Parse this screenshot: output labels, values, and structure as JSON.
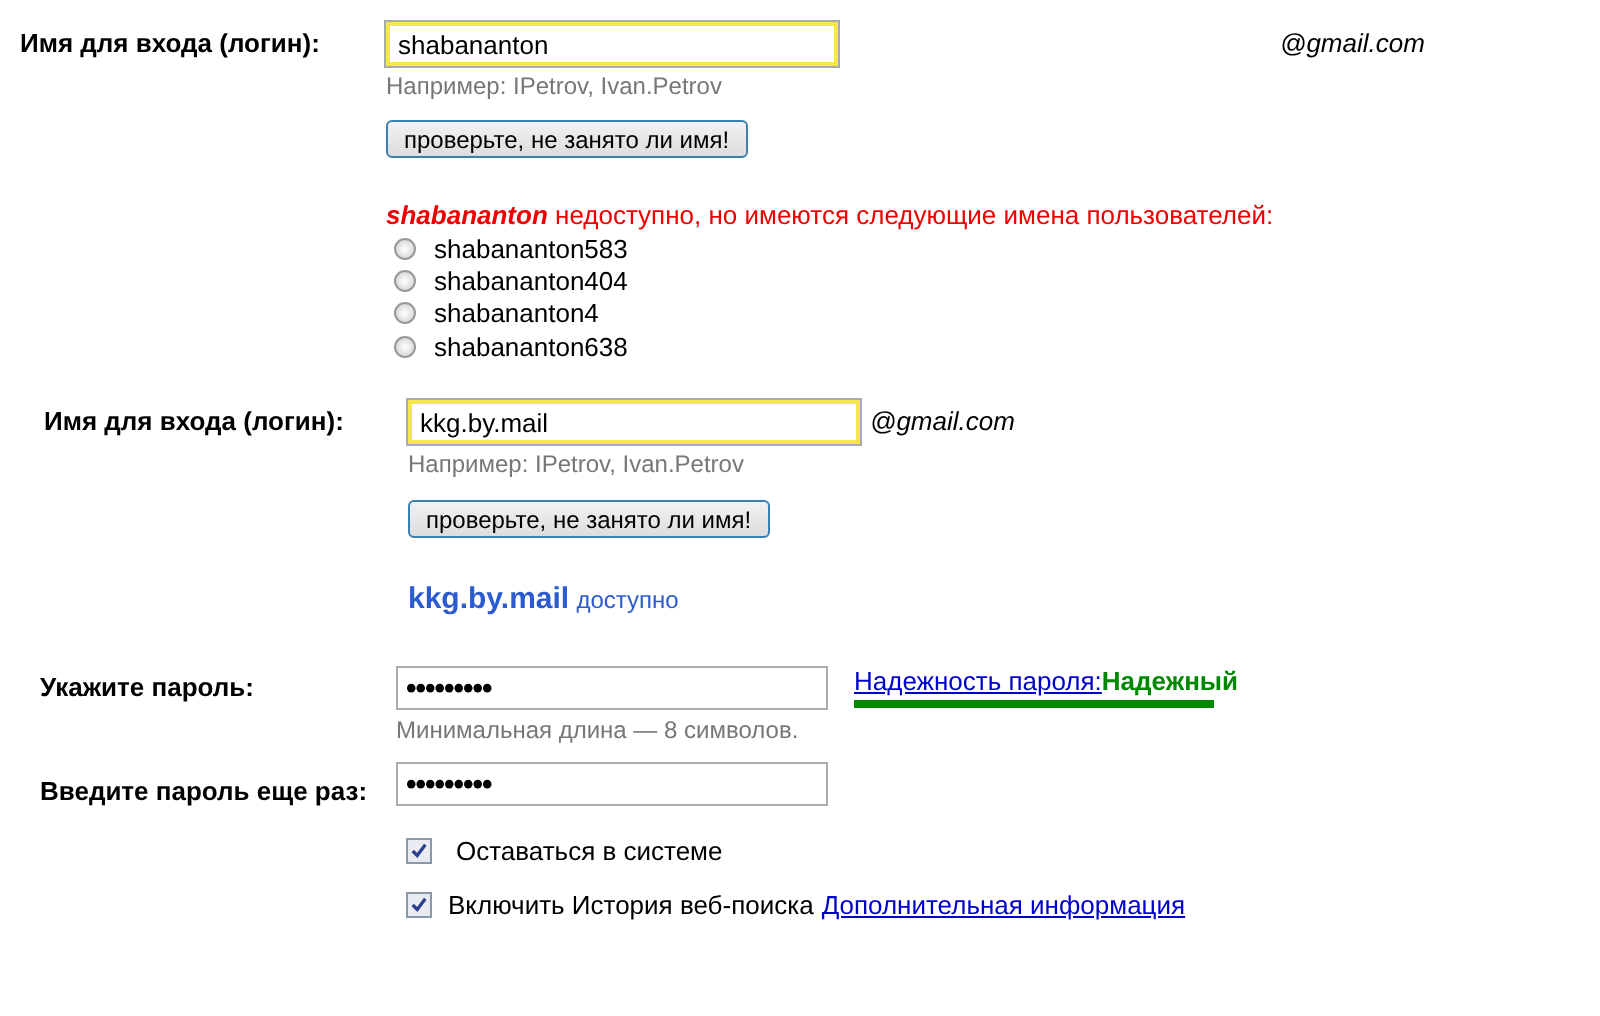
{
  "first_check": {
    "label": "Имя для входа (логин):",
    "value": "shabananton",
    "domain": "@gmail.com",
    "hint": "Например: IPetrov, Ivan.Petrov",
    "button": "проверьте, не занято ли имя!",
    "taken_name": "shabananton",
    "message": "недоступно, но имеются следующие имена пользователей:",
    "suggestions": [
      {
        "label": "shabananton583",
        "selected": false
      },
      {
        "label": "shabananton404",
        "selected": false
      },
      {
        "label": "shabananton4",
        "selected": false
      },
      {
        "label": "shabananton638",
        "selected": false
      }
    ]
  },
  "second_check": {
    "label": "Имя для входа (логин):",
    "value": "kkg.by.mail",
    "domain": "@gmail.com",
    "hint": "Например: IPetrov, Ivan.Petrov",
    "button": "проверьте, не занято ли имя!",
    "available_name": "kkg.by.mail",
    "available_text": "доступно"
  },
  "password": {
    "label": "Укажите пароль:",
    "value": "•••••••••",
    "hint": "Минимальная длина — 8 символов.",
    "strength_link": "Надежность пароля:",
    "strength": "Надежный"
  },
  "confirm": {
    "label": "Введите пароль еще раз:",
    "value": "•••••••••"
  },
  "options": [
    {
      "label": "Оставаться в системе",
      "checked": true
    },
    {
      "label": "Включить История веб-поиска",
      "checked": true,
      "link": "Дополнительная информация"
    }
  ]
}
